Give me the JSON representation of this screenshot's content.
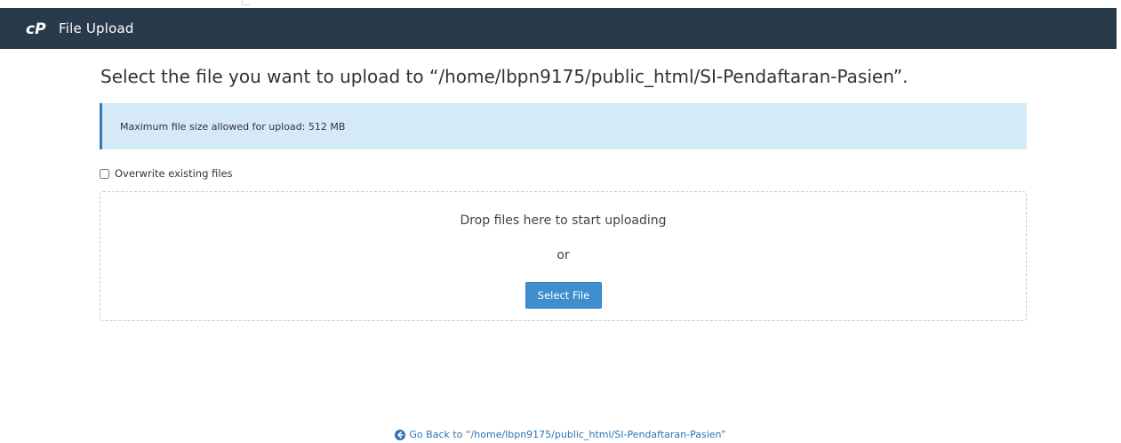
{
  "header": {
    "title": "File Upload",
    "logo_icon": "cpanel-logo-icon",
    "background": "#293a4a"
  },
  "main": {
    "heading": "Select the file you want to upload to “/home/lbpn9175/public_html/SI-Pendaftaran-Pasien”.",
    "info_text": "Maximum file size allowed for upload: 512 MB",
    "overwrite_label": "Overwrite existing files",
    "overwrite_checked": false,
    "dropzone": {
      "drop_text": "Drop files here to start uploading",
      "or_text": "or",
      "select_button_label": "Select File"
    },
    "go_back_text": "Go Back to “/home/lbpn9175/public_html/SI-Pendaftaran-Pasien”",
    "go_back_icon": "arrow-circle-left-icon"
  },
  "colors": {
    "accent": "#3f8fd0",
    "info_background": "#d5eaf7",
    "info_border": "#2e7bb7",
    "link": "#2f73b1"
  }
}
